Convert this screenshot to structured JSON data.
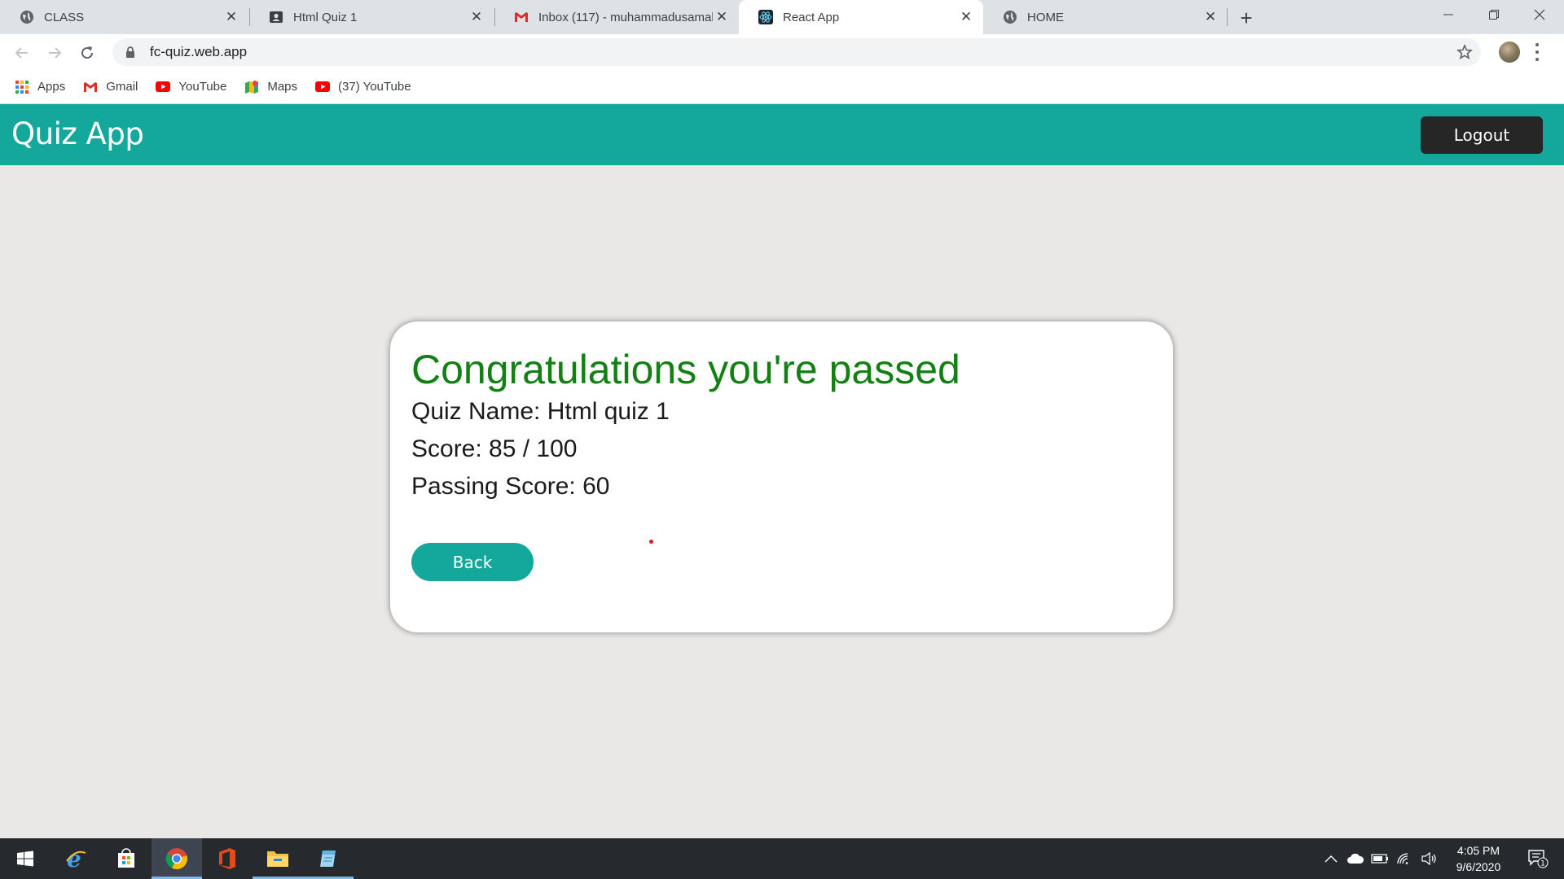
{
  "browser": {
    "tabs": [
      {
        "title": "CLASS",
        "icon": "globe-icon",
        "active": false
      },
      {
        "title": "Html Quiz 1",
        "icon": "contact-card-icon",
        "active": false
      },
      {
        "title": "Inbox (117) - muhammadusamah",
        "icon": "gmail-icon",
        "active": false
      },
      {
        "title": "React App",
        "icon": "react-icon",
        "active": true
      },
      {
        "title": "HOME",
        "icon": "globe-icon",
        "active": false
      }
    ],
    "url": "fc-quiz.web.app",
    "bookmarks": [
      {
        "label": "Apps",
        "icon": "apps-grid-icon"
      },
      {
        "label": "Gmail",
        "icon": "gmail-icon"
      },
      {
        "label": "YouTube",
        "icon": "youtube-icon"
      },
      {
        "label": "Maps",
        "icon": "maps-icon"
      },
      {
        "label": "(37) YouTube",
        "icon": "youtube-icon"
      }
    ]
  },
  "app": {
    "title": "Quiz App",
    "logout_label": "Logout",
    "brand_color": "#14a79b"
  },
  "result": {
    "heading": "Congratulations you're passed",
    "quiz_name": "Quiz Name: Html quiz 1",
    "score": "Score: 85 / 100",
    "passing_score": "Passing Score: 60",
    "back_label": "Back",
    "heading_color": "#128013"
  },
  "taskbar": {
    "apps": [
      "start-icon",
      "internet-explorer-icon",
      "store-icon",
      "chrome-icon",
      "office-icon",
      "file-explorer-icon",
      "notepad-icon"
    ],
    "time": "4:05 PM",
    "date": "9/6/2020",
    "notification_count": "1"
  }
}
